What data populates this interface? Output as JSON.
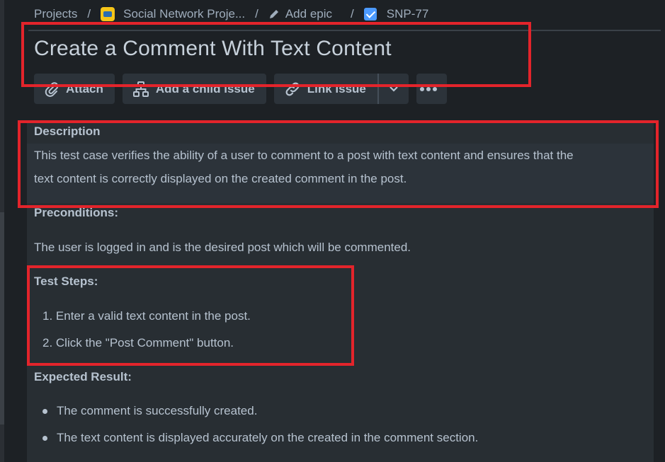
{
  "breadcrumb": {
    "projects": "Projects",
    "project_name": "Social Network Proje...",
    "epic": "Add epic",
    "issue_key": "SNP-77"
  },
  "issue": {
    "title": "Create a Comment With Text Content"
  },
  "toolbar": {
    "attach_label": "Attach",
    "child_issue_label": "Add a child issue",
    "link_issue_label": "Link issue"
  },
  "description": {
    "heading": "Description",
    "text_line1": "This test case verifies the ability of a user to comment to a post with text content and ensures that the",
    "text_line2": "text content is correctly displayed on the created comment in the post.",
    "preconditions_heading": "Preconditions:",
    "preconditions_text": "The user is logged in and is the desired post which will be commented.",
    "steps_heading": "Test Steps:",
    "steps": [
      "1. Enter a valid text content in the post.",
      "2. Click the \"Post Comment\" button."
    ],
    "expected_heading": "Expected Result:",
    "expected": [
      "The comment is successfully created.",
      "The text content is displayed accurately on the created in the comment section."
    ]
  },
  "colors": {
    "annotation_red": "#e3242b",
    "background": "#1d2125",
    "panel": "#282e33",
    "accent_blue": "#4c9aff",
    "project_icon_yellow": "#f5c518"
  },
  "icons": {
    "attach": "paperclip-icon",
    "child_issue": "hierarchy-icon",
    "link_issue": "link-icon",
    "dropdown": "chevron-down-icon",
    "more": "more-horizontal-icon",
    "epic": "pencil-icon",
    "issue_type": "checkbox-icon"
  }
}
